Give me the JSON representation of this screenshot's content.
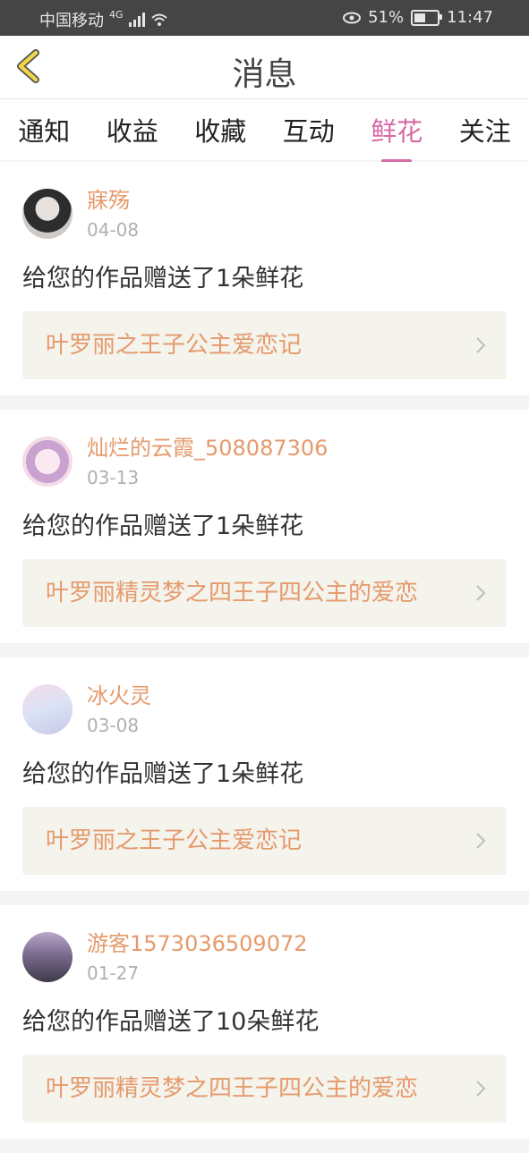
{
  "status": {
    "carrier": "中国移动",
    "network": "4G",
    "battery": "51%",
    "battery_level": 0.51,
    "time": "11:47"
  },
  "header": {
    "title": "消息"
  },
  "tabs": [
    "通知",
    "收益",
    "收藏",
    "互动",
    "鲜花",
    "关注"
  ],
  "active_tab": 4,
  "colors": {
    "accent": "#d86aa5",
    "name": "#e59a6c",
    "back": "#f0d648"
  },
  "items": [
    {
      "user": "寐殇",
      "date": "04-08",
      "message": "给您的作品赠送了1朵鲜花",
      "work": "叶罗丽之王子公主爱恋记"
    },
    {
      "user": "灿烂的云霞_508087306",
      "date": "03-13",
      "message": "给您的作品赠送了1朵鲜花",
      "work": "叶罗丽精灵梦之四王子四公主的爱恋"
    },
    {
      "user": "冰火灵",
      "date": "03-08",
      "message": "给您的作品赠送了1朵鲜花",
      "work": "叶罗丽之王子公主爱恋记"
    },
    {
      "user": "游客1573036509072",
      "date": "01-27",
      "message": "给您的作品赠送了10朵鲜花",
      "work": "叶罗丽精灵梦之四王子四公主的爱恋"
    }
  ]
}
